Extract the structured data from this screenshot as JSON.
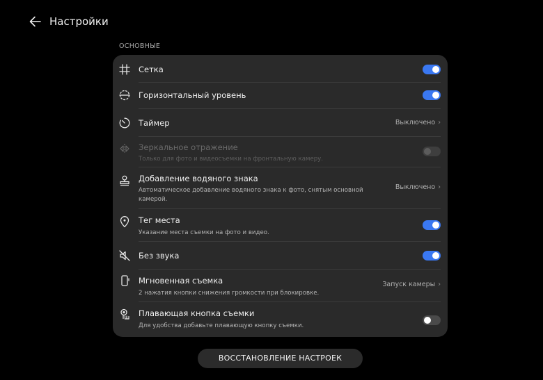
{
  "header": {
    "title": "Настройки"
  },
  "section": {
    "label": "ОСНОВНЫЕ"
  },
  "colors": {
    "accent": "#3a78f2",
    "card": "#2a2a2a",
    "background": "#000000"
  },
  "rows": [
    {
      "icon": "grid-icon",
      "title": "Сетка",
      "subtitle": "",
      "control": "toggle",
      "toggle_on": true
    },
    {
      "icon": "level-icon",
      "title": "Горизонтальный уровень",
      "subtitle": "",
      "control": "toggle",
      "toggle_on": true
    },
    {
      "icon": "timer-icon",
      "title": "Таймер",
      "subtitle": "",
      "control": "value",
      "value": "Выключено"
    },
    {
      "icon": "mirror-icon",
      "title": "Зеркальное отражение",
      "subtitle": "Только для фото и видеосъемки на фронтальную камеру.",
      "control": "toggle",
      "toggle_on": false,
      "disabled": true
    },
    {
      "icon": "watermark-icon",
      "title": "Добавление водяного знака",
      "subtitle": "Автоматическое добавление водяного знака к фото, снятым основной камерой.",
      "control": "value",
      "value": "Выключено"
    },
    {
      "icon": "location-icon",
      "title": "Тег места",
      "subtitle": "Указание места съемки на фото и видео.",
      "control": "toggle",
      "toggle_on": true
    },
    {
      "icon": "mute-icon",
      "title": "Без звука",
      "subtitle": "",
      "control": "toggle",
      "toggle_on": true
    },
    {
      "icon": "phone-icon",
      "title": "Мгновенная съемка",
      "subtitle": "2 нажатия кнопки снижения громкости при блокировке.",
      "control": "value",
      "value": "Запуск камеры"
    },
    {
      "icon": "floating-shutter-icon",
      "title": "Плавающая кнопка съемки",
      "subtitle": "Для удобства добавьте плавающую кнопку съемки.",
      "control": "toggle",
      "toggle_on": false
    }
  ],
  "reset_button": {
    "label": "ВОССТАНОВЛЕНИЕ НАСТРОЕК"
  }
}
